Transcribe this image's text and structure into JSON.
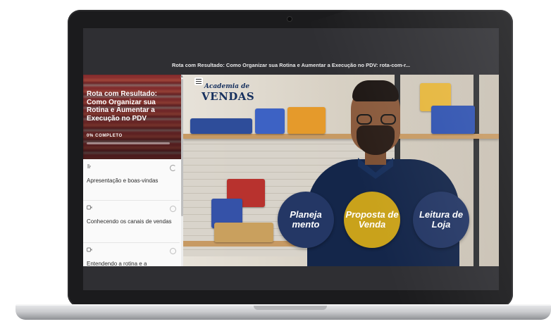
{
  "window": {
    "title": "Rota com Resultado: Como Organizar sua Rotina e Aumentar a Execução no PDV: rota-com-r..."
  },
  "course": {
    "title": "Rota com Resultado: Como Organizar sua Rotina e Aumentar a Execução no PDV",
    "progress_label": "0% COMPLETO",
    "progress_fraction": 0.0
  },
  "lessons": [
    {
      "label": "Apresentação e boas-vindas",
      "type_icon": "text-lesson-icon",
      "status": "in-progress"
    },
    {
      "label": "Conhecendo os canais de vendas",
      "type_icon": "video-lesson-icon",
      "status": "not-started"
    },
    {
      "label": "Entendendo a rotina e a",
      "type_icon": "video-lesson-icon",
      "status": "not-started"
    }
  ],
  "video": {
    "logo_line1": "Academia de",
    "logo_line2": "VENDAS",
    "circles": [
      {
        "label": "Planeja mento",
        "color": "#243765"
      },
      {
        "label": "Proposta de Venda",
        "color": "#c9a21b"
      },
      {
        "label": "Leitura de Loja",
        "color": "#243765"
      }
    ]
  },
  "icons": {
    "menu": "hamburger-menu-icon",
    "camera": "webcam-icon"
  },
  "colors": {
    "frame": "#1b1b1d",
    "screen_bg": "#2f2f33",
    "brand_navy": "#243765",
    "brand_gold": "#c9a21b"
  }
}
